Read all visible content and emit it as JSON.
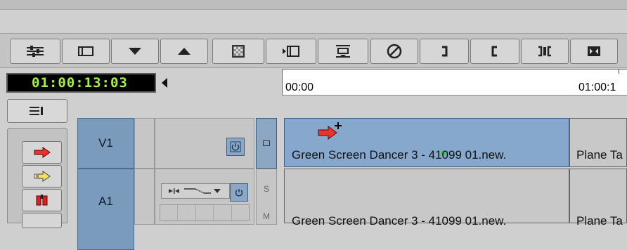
{
  "timecode": {
    "value": "01:00:13:03",
    "color": "#a6f04a"
  },
  "ruler": {
    "start_label": "00:00",
    "end_label": "01:00:1"
  },
  "toolbar": {
    "buttons": [
      "sliders-icon",
      "source-monitor-icon",
      "lower-triangle-icon",
      "raise-triangle-icon",
      "checkerboard-icon",
      "film-step-icon",
      "splice-icon",
      "no-entry-icon",
      "mark-out-bracket-icon",
      "mark-in-bracket-icon",
      "clear-marks-icon",
      "lift-icon"
    ]
  },
  "tracks": {
    "v1": {
      "label": "V1"
    },
    "a1": {
      "label": "A1"
    },
    "a1_s": "S",
    "a1_m": "M"
  },
  "clips": {
    "v1_main": "Green Screen Dancer 3 - 41099 01.new.",
    "v1_next": "Plane Ta",
    "a1_main": "Green Screen Dancer 3 - 41099 01.new.",
    "a1_next": "Plane Ta"
  },
  "colors": {
    "clip_selected": "#86a8cc",
    "track_header": "#7b9bbd",
    "arrow_red": "#e8332f",
    "arrow_yellow": "#f4e25a"
  }
}
